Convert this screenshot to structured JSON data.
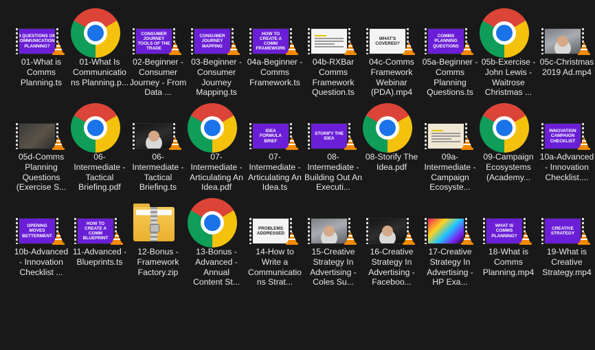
{
  "files": [
    {
      "name": "01-What is Comms Planning.ts",
      "type": "video",
      "thumb": "purple",
      "title": "4 QUESTIONS ON COMMUNICATIONS PLANNING?"
    },
    {
      "name": "01-What Is Communications Planning.p...",
      "type": "chrome"
    },
    {
      "name": "02-Beginner - Consumer Journey - From Data ...",
      "type": "video",
      "thumb": "purple",
      "title": "CONSUMER JOURNEY TOOLS OF THE TRADE"
    },
    {
      "name": "03-Beginner - Consumer Journey Mapping.ts",
      "type": "video",
      "thumb": "purple",
      "title": "CONSUMER JOURNEY MAPPING"
    },
    {
      "name": "04a-Beginner - Comms Framework.ts",
      "type": "video",
      "thumb": "purple",
      "title": "HOW TO CREATE A COMM FRAMEWORK"
    },
    {
      "name": "04b-RXBar Comms Framework Question.ts",
      "type": "video",
      "thumb": "white",
      "title": ""
    },
    {
      "name": "04c-Comms Framework Webinar (PDA).mp4",
      "type": "video",
      "thumb": "white",
      "title": "WHAT'S COVERED?"
    },
    {
      "name": "05a-Beginner - Comms Planning Questions.ts",
      "type": "video",
      "thumb": "purple",
      "title": "COMMS PLANNING QUESTIONS"
    },
    {
      "name": "05b-Exercise - John Lewis - Waitrose Christmas ...",
      "type": "chrome"
    },
    {
      "name": "05c-Christmas 2019 Ad.mp4",
      "type": "video",
      "thumb": "photo2",
      "title": ""
    },
    {
      "name": "05d-Comms Planning Questions (Exercise S...",
      "type": "video",
      "thumb": "photo",
      "title": ""
    },
    {
      "name": "06-Intermediate - Tactical Briefing.pdf",
      "type": "chrome"
    },
    {
      "name": "06-Intermediate - Tactical Briefing.ts",
      "type": "video",
      "thumb": "dark",
      "title": ""
    },
    {
      "name": "07-Intermediate - Articulating An Idea.pdf",
      "type": "chrome"
    },
    {
      "name": "07-Intermediate - Articulating An Idea.ts",
      "type": "video",
      "thumb": "purple",
      "title": "IDEA FORMULA BRIEF"
    },
    {
      "name": "08-Intermediate - Building Out An Executi...",
      "type": "video",
      "thumb": "purple",
      "title": "STORIFY THE IDEA"
    },
    {
      "name": "08-Storify The Idea.pdf",
      "type": "chrome"
    },
    {
      "name": "09a-Intermediate - Campaign Ecosyste...",
      "type": "video",
      "thumb": "beige",
      "title": ""
    },
    {
      "name": "09-Campaign Ecosystems (Academy...",
      "type": "chrome"
    },
    {
      "name": "10a-Advanced - Innovation Checklist....",
      "type": "video",
      "thumb": "purple",
      "title": "INNOVATION CAMPAIGN CHECKLIST"
    },
    {
      "name": "10b-Advanced - Innovation Checklist ...",
      "type": "video",
      "thumb": "purple",
      "title": "OPENING MOVES BETTERMENT"
    },
    {
      "name": "11-Advanced - Blueprints.ts",
      "type": "video",
      "thumb": "purple",
      "title": "HOW TO CREATE A COMM BLUEPRINT"
    },
    {
      "name": "12-Bonus - Framework Factory.zip",
      "type": "zip"
    },
    {
      "name": "13-Bonus - Advanced - Annual Content St...",
      "type": "chrome"
    },
    {
      "name": "14-How to Write a Communications Strat...",
      "type": "video",
      "thumb": "white",
      "title": "PROBLEMS ADDRESSED"
    },
    {
      "name": "15-Creative Strategy In Advertising - Coles Su...",
      "type": "video",
      "thumb": "photo2",
      "title": ""
    },
    {
      "name": "16-Creative Strategy In Advertising - Faceboo...",
      "type": "video",
      "thumb": "dark",
      "title": ""
    },
    {
      "name": "17-Creative Strategy In Advertising - HP Exa...",
      "type": "video",
      "thumb": "colorful",
      "title": ""
    },
    {
      "name": "18-What is Comms Planning.mp4",
      "type": "video",
      "thumb": "purple",
      "title": "WHAT IS COMMS PLANNING?"
    },
    {
      "name": "19-What is Creative Strategy.mp4",
      "type": "video",
      "thumb": "purple",
      "title": "CREATIVE STRATEGY"
    }
  ],
  "icons": {
    "video_overlay": "vlc-cone-icon",
    "chrome": "chrome-icon",
    "zip": "zip-folder-icon"
  },
  "colors": {
    "background": "#191919",
    "text": "#e8e8e8",
    "purple": "#6a1fd6",
    "vlc_orange": "#f28a00"
  }
}
